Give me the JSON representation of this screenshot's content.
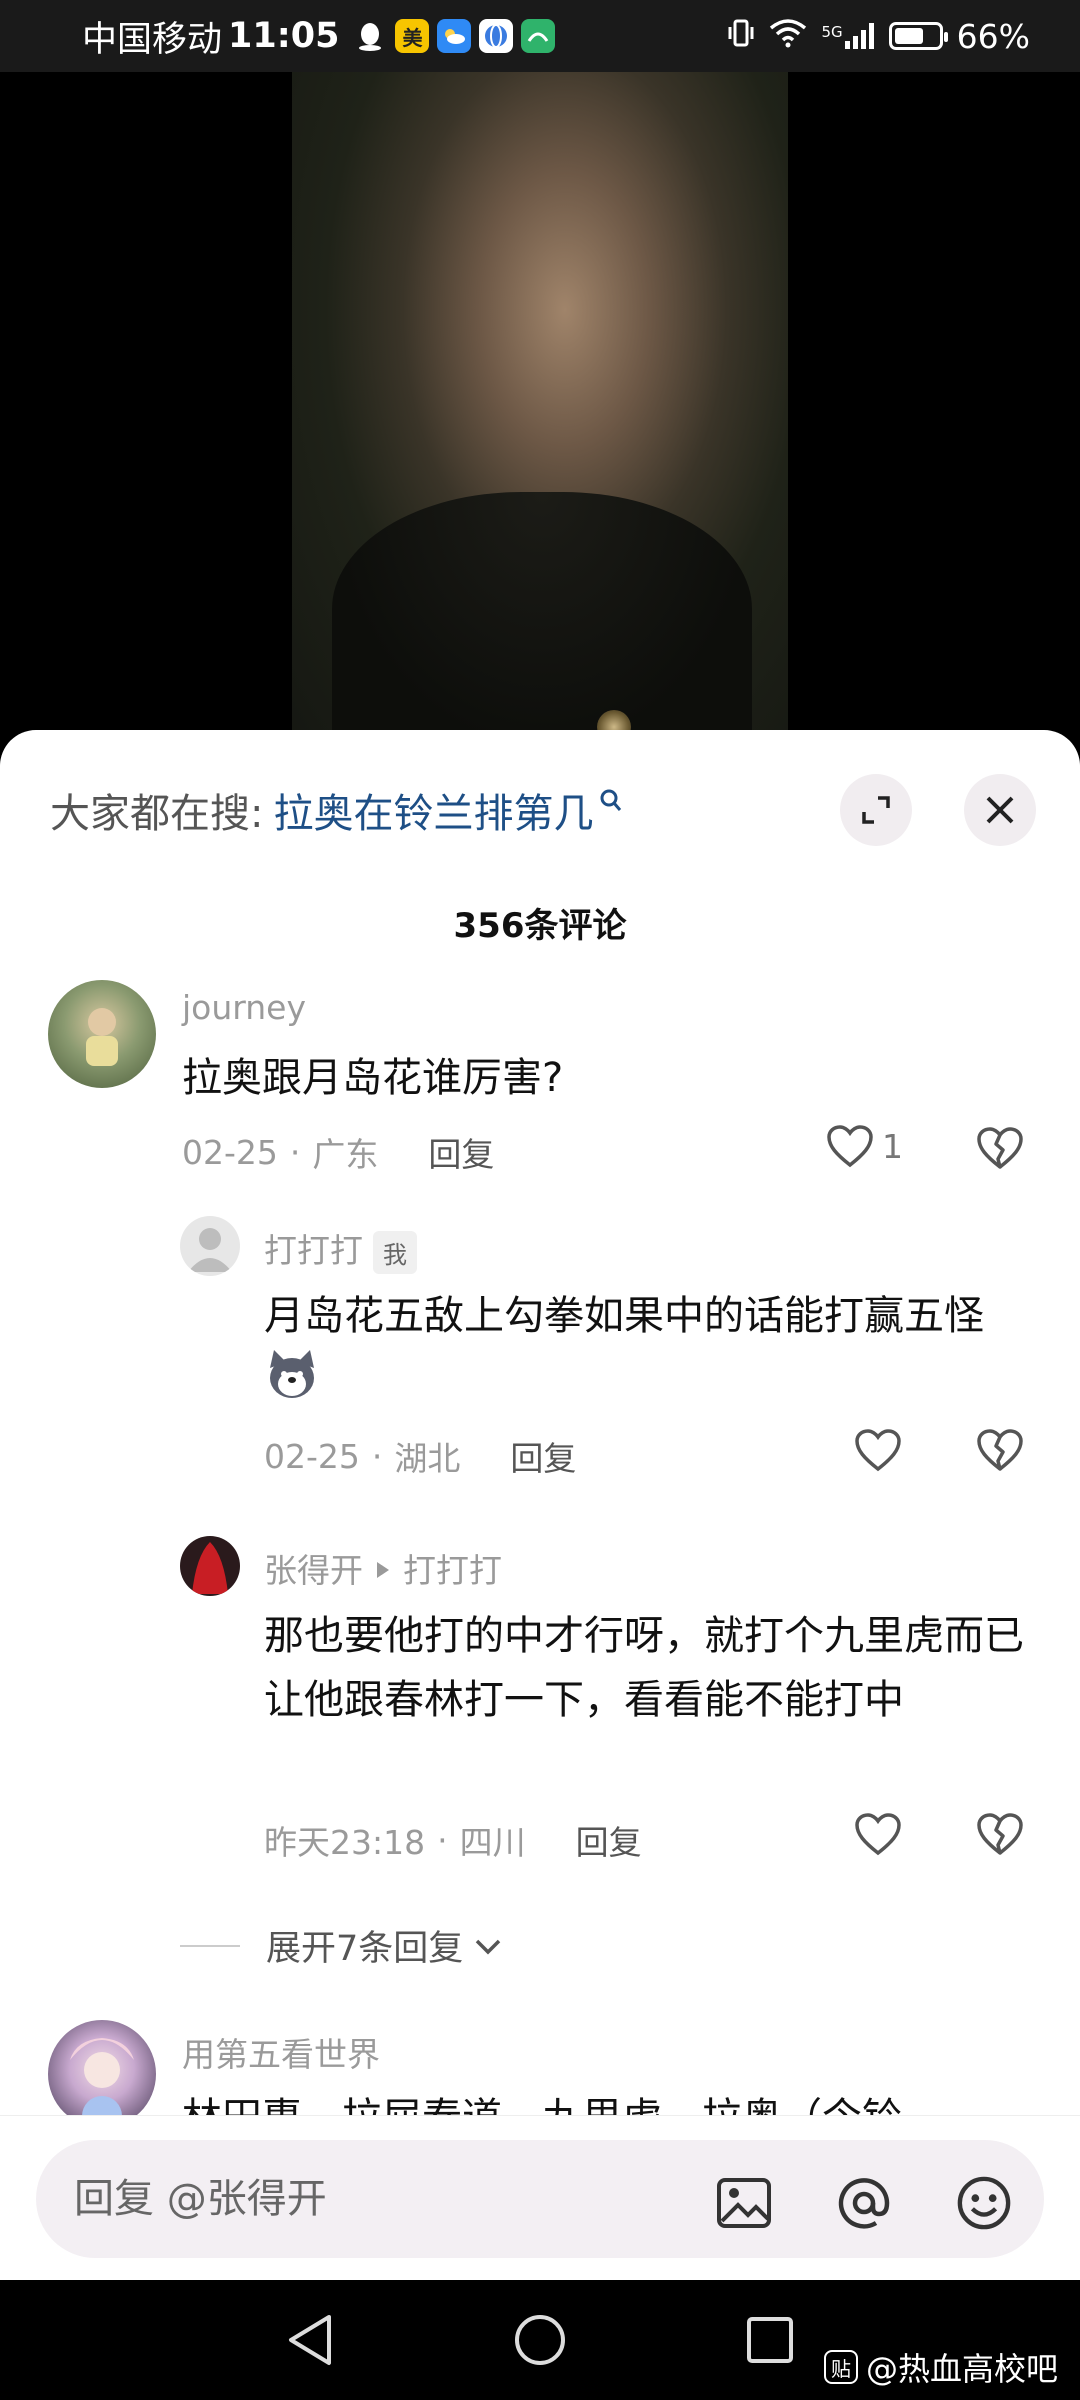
{
  "status_bar": {
    "carrier": "中国移动",
    "time": "11:05",
    "app_icons": [
      {
        "name": "qq-icon",
        "label": "",
        "color": "#000000"
      },
      {
        "name": "meituan-icon",
        "label": "美",
        "color": "#f7c500"
      },
      {
        "name": "weather-icon",
        "label": "",
        "color": "#2f8af5"
      },
      {
        "name": "browser-icon",
        "label": "",
        "color": "#3a7be0"
      },
      {
        "name": "app-icon",
        "label": "",
        "color": "#2fb36b"
      }
    ],
    "network": "5G",
    "battery": "66%",
    "battery_level": 0.66
  },
  "sheet": {
    "search_prefix": "大家都在搜:",
    "search_query": "拉奥在铃兰排第几",
    "comment_count": "356条评论"
  },
  "comments": [
    {
      "username": "journey",
      "text": "拉奥跟月岛花谁厉害?",
      "date": "02-25",
      "location": "广东",
      "reply_label": "回复",
      "likes": "1"
    },
    {
      "username": "打打打",
      "badge": "我",
      "text": "月岛花五敌上勾拳如果中的话能打赢五怪",
      "date": "02-25",
      "location": "湖北",
      "reply_label": "回复"
    },
    {
      "username": "张得开",
      "reply_to": "打打打",
      "text": "那也要他打的中才行呀，就打个九里虎而已让他跟春林打一下，看看能不能打中",
      "date": "昨天23:18",
      "location": "四川",
      "reply_label": "回复"
    },
    {
      "username": "用第五看世界",
      "text": "林田惠、拉屈春道、九里虎、拉奥（今铃"
    }
  ],
  "expand_replies": "展开7条回复",
  "input": {
    "placeholder": "回复 @张得开"
  },
  "watermark": {
    "logo": "贴",
    "text": "@热血高校吧"
  }
}
